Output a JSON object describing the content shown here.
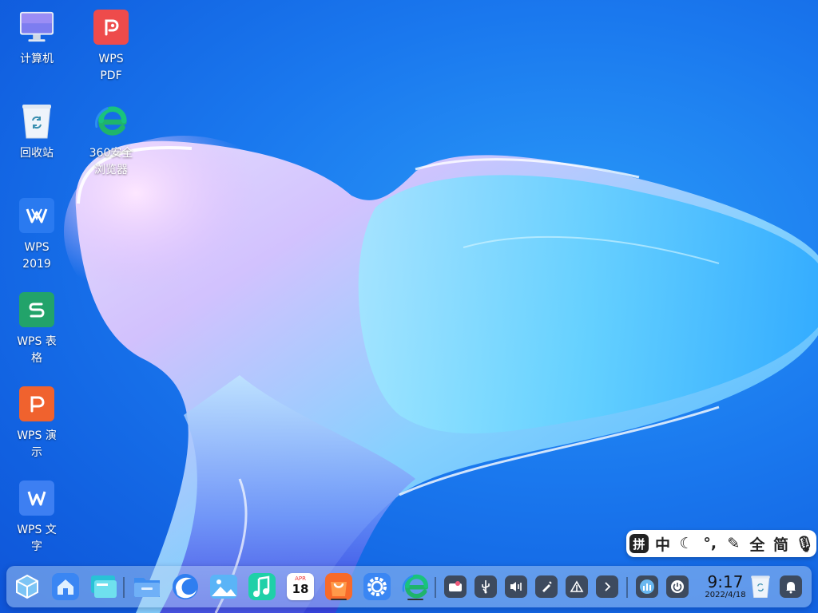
{
  "desktop": {
    "icons": [
      {
        "label": "计算机",
        "icon": "computer-icon"
      },
      {
        "label": "WPS\nPDF",
        "icon": "wps-pdf-icon"
      },
      {
        "label": "回收站",
        "icon": "trash-icon"
      },
      {
        "label": "360安全\n浏览器",
        "icon": "browser-360-icon"
      },
      {
        "label": "WPS\n2019",
        "icon": "wps-2019-icon"
      },
      {
        "label": "WPS 表\n格",
        "icon": "wps-spreadsheet-icon"
      },
      {
        "label": "WPS 演\n示",
        "icon": "wps-presentation-icon"
      },
      {
        "label": "WPS 文\n字",
        "icon": "wps-writer-icon"
      }
    ]
  },
  "ime": {
    "items": [
      "拼",
      "中",
      "☾",
      "°,",
      "✎",
      "全",
      "简",
      "🎙"
    ]
  },
  "taskbar": {
    "calendar_month": "APR",
    "calendar_day": "18",
    "clock_time": "9:17",
    "clock_date": "2022/4/18"
  },
  "colors": {
    "wallpaper": "#1e7ef2",
    "taskbar": "#bed7f5",
    "tray_button": "#3d4a5e"
  }
}
